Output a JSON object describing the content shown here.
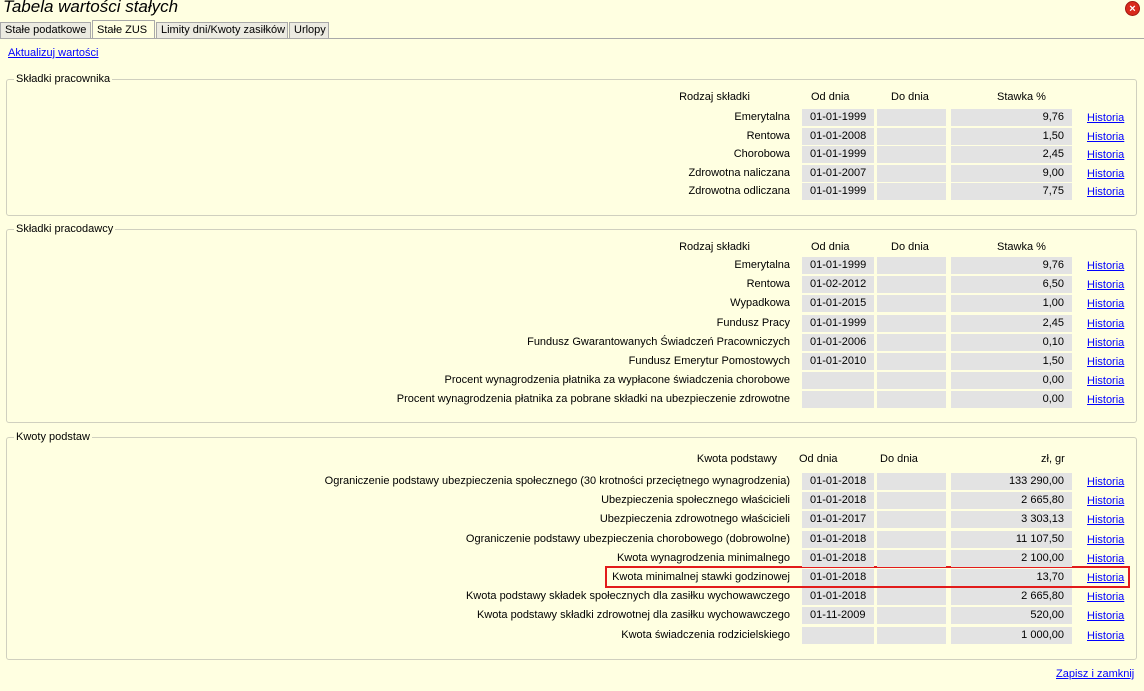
{
  "window": {
    "title": "Tabela wartości stałych",
    "close_label": "×"
  },
  "tabs": [
    {
      "label": "Stałe podatkowe"
    },
    {
      "label": "Stałe ZUS"
    },
    {
      "label": "Limity dni/Kwoty zasiłków"
    },
    {
      "label": "Urlopy"
    }
  ],
  "refresh_link": "Aktualizuj wartości",
  "save_link": "Zapisz i zamknij",
  "employee": {
    "title": "Składki pracownika",
    "headers": {
      "type": "Rodzaj składki",
      "from": "Od dnia",
      "to": "Do dnia",
      "rate": "Stawka %"
    },
    "rows": [
      {
        "label": "Emerytalna",
        "from": "01-01-1999",
        "to": "",
        "rate": "9,76",
        "history": "Historia"
      },
      {
        "label": "Rentowa",
        "from": "01-01-2008",
        "to": "",
        "rate": "1,50",
        "history": "Historia"
      },
      {
        "label": "Chorobowa",
        "from": "01-01-1999",
        "to": "",
        "rate": "2,45",
        "history": "Historia"
      },
      {
        "label": "Zdrowotna naliczana",
        "from": "01-01-2007",
        "to": "",
        "rate": "9,00",
        "history": "Historia"
      },
      {
        "label": "Zdrowotna odliczana",
        "from": "01-01-1999",
        "to": "",
        "rate": "7,75",
        "history": "Historia"
      }
    ]
  },
  "employer": {
    "title": "Składki pracodawcy",
    "headers": {
      "type": "Rodzaj składki",
      "from": "Od dnia",
      "to": "Do dnia",
      "rate": "Stawka %"
    },
    "rows": [
      {
        "label": "Emerytalna",
        "from": "01-01-1999",
        "to": "",
        "rate": "9,76",
        "history": "Historia"
      },
      {
        "label": "Rentowa",
        "from": "01-02-2012",
        "to": "",
        "rate": "6,50",
        "history": "Historia"
      },
      {
        "label": "Wypadkowa",
        "from": "01-01-2015",
        "to": "",
        "rate": "1,00",
        "history": "Historia"
      },
      {
        "label": "Fundusz Pracy",
        "from": "01-01-1999",
        "to": "",
        "rate": "2,45",
        "history": "Historia"
      },
      {
        "label": "Fundusz Gwarantowanych Świadczeń Pracowniczych",
        "from": "01-01-2006",
        "to": "",
        "rate": "0,10",
        "history": "Historia"
      },
      {
        "label": "Fundusz Emerytur Pomostowych",
        "from": "01-01-2010",
        "to": "",
        "rate": "1,50",
        "history": "Historia"
      },
      {
        "label": "Procent wynagrodzenia płatnika za wypłacone świadczenia chorobowe",
        "from": "",
        "to": "",
        "rate": "0,00",
        "history": "Historia"
      },
      {
        "label": "Procent wynagrodzenia płatnika za pobrane składki na ubezpieczenie zdrowotne",
        "from": "",
        "to": "",
        "rate": "0,00",
        "history": "Historia"
      }
    ]
  },
  "bases": {
    "title": "Kwoty podstaw",
    "headers": {
      "type": "Kwota podstawy",
      "from": "Od dnia",
      "to": "Do dnia",
      "rate": "zł, gr"
    },
    "rows": [
      {
        "label": "Ograniczenie podstawy ubezpieczenia społecznego (30 krotności przeciętnego wynagrodzenia)",
        "from": "01-01-2018",
        "to": "",
        "rate": "133 290,00",
        "history": "Historia"
      },
      {
        "label": "Ubezpieczenia społecznego właścicieli",
        "from": "01-01-2018",
        "to": "",
        "rate": "2 665,80",
        "history": "Historia"
      },
      {
        "label": "Ubezpieczenia zdrowotnego właścicieli",
        "from": "01-01-2017",
        "to": "",
        "rate": "3 303,13",
        "history": "Historia"
      },
      {
        "label": "Ograniczenie podstawy ubezpieczenia chorobowego (dobrowolne)",
        "from": "01-01-2018",
        "to": "",
        "rate": "11 107,50",
        "history": "Historia"
      },
      {
        "label": "Kwota wynagrodzenia minimalnego",
        "from": "01-01-2018",
        "to": "",
        "rate": "2 100,00",
        "history": "Historia"
      },
      {
        "label": "Kwota minimalnej stawki godzinowej",
        "from": "01-01-2018",
        "to": "",
        "rate": "13,70",
        "history": "Historia"
      },
      {
        "label": "Kwota podstawy składek społecznych dla zasiłku wychowawczego",
        "from": "01-01-2018",
        "to": "",
        "rate": "2 665,80",
        "history": "Historia"
      },
      {
        "label": "Kwota podstawy składki zdrowotnej dla zasiłku wychowawczego",
        "from": "01-11-2009",
        "to": "",
        "rate": "520,00",
        "history": "Historia"
      },
      {
        "label": "Kwota świadczenia rodzicielskiego",
        "from": "",
        "to": "",
        "rate": "1 000,00",
        "history": "Historia"
      }
    ]
  },
  "colors": {
    "background": "#ffffe1",
    "cell": "#e3e3e3",
    "link": "#0000ff",
    "highlight": "#e21b1b"
  }
}
